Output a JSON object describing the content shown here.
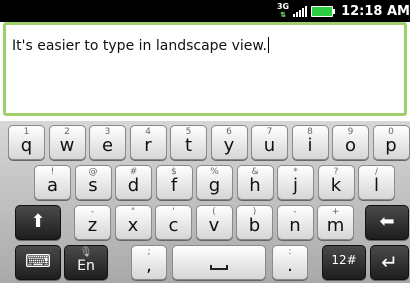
{
  "status_bar": {
    "network": "3G",
    "network_icon": "3g-data-icon",
    "signal_icon": "signal-bars-icon",
    "battery_icon": "battery-icon",
    "time": "12:18 AM"
  },
  "editor": {
    "text": "It's easier to type in landscape view."
  },
  "keyboard": {
    "row1": [
      {
        "hint": "1",
        "main": "q"
      },
      {
        "hint": "2",
        "main": "w"
      },
      {
        "hint": "3",
        "main": "e"
      },
      {
        "hint": "4",
        "main": "r"
      },
      {
        "hint": "5",
        "main": "t"
      },
      {
        "hint": "6",
        "main": "y"
      },
      {
        "hint": "7",
        "main": "u"
      },
      {
        "hint": "8",
        "main": "i"
      },
      {
        "hint": "9",
        "main": "o"
      },
      {
        "hint": "0",
        "main": "p"
      }
    ],
    "row2": [
      {
        "hint": "!",
        "main": "a"
      },
      {
        "hint": "@",
        "main": "s"
      },
      {
        "hint": "#",
        "main": "d"
      },
      {
        "hint": "$",
        "main": "f"
      },
      {
        "hint": "%",
        "main": "g"
      },
      {
        "hint": "&",
        "main": "h"
      },
      {
        "hint": "*",
        "main": "j"
      },
      {
        "hint": "?",
        "main": "k"
      },
      {
        "hint": "/",
        "main": "l"
      }
    ],
    "row3": [
      {
        "hint": "-",
        "main": "z"
      },
      {
        "hint": "\"",
        "main": "x"
      },
      {
        "hint": "'",
        "main": "c"
      },
      {
        "hint": "(",
        "main": "v"
      },
      {
        "hint": ")",
        "main": "b"
      },
      {
        "hint": "-",
        "main": "n"
      },
      {
        "hint": "+",
        "main": "m"
      }
    ],
    "shift_icon": "shift-arrow-icon",
    "backspace_icon": "backspace-arrow-icon",
    "keyboard_icon": "hide-keyboard-icon",
    "mic_icon": "microphone-icon",
    "language_label": "En",
    "comma": {
      "hint": ";",
      "main": ","
    },
    "space_icon": "space-icon",
    "period": {
      "hint": ":",
      "main": "."
    },
    "symbols_label": "12#",
    "enter_icon": "enter-arrow-icon"
  }
}
